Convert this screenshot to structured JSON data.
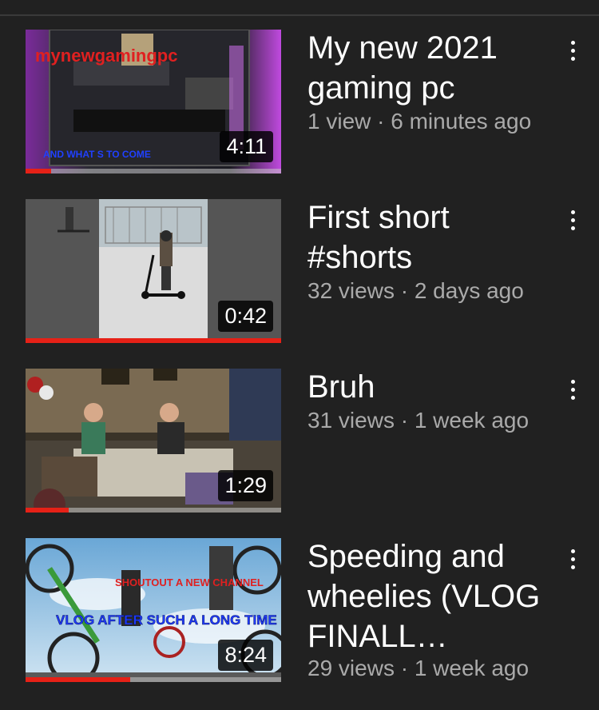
{
  "videos": [
    {
      "title": "My new 2021 gaming pc",
      "meta": "1 view · 6 minutes ago",
      "duration": "4:11",
      "progress": 0.1,
      "thumb_text_top": "mynewgamingpc",
      "thumb_text_bottom": "AND WHAT S TO COME"
    },
    {
      "title": "First short #shorts",
      "meta": "32 views · 2 days ago",
      "duration": "0:42",
      "progress": 1.0
    },
    {
      "title": "Bruh",
      "meta": "31 views · 1 week ago",
      "duration": "1:29",
      "progress": 0.17
    },
    {
      "title": "Speeding and wheelies (VLOG FINALL…",
      "meta": "29 views · 1 week ago",
      "duration": "8:24",
      "progress": 0.41,
      "thumb_text_top": "SHOUTOUT A NEW CHANNEL",
      "thumb_text_bottom": "VLOG AFTER SUCH A LONG TIME"
    }
  ],
  "icons": {
    "more": "more-vert-icon"
  },
  "colors": {
    "background": "#212121",
    "progress": "#e62117",
    "meta_text": "#aaaaaa"
  }
}
